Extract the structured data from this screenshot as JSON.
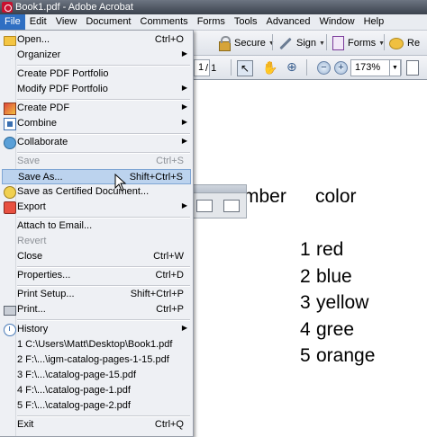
{
  "window": {
    "title": "Book1.pdf - Adobe Acrobat"
  },
  "menubar": {
    "items": [
      "File",
      "Edit",
      "View",
      "Document",
      "Comments",
      "Forms",
      "Tools",
      "Advanced",
      "Window",
      "Help"
    ],
    "active": "File"
  },
  "toolbar": {
    "secure_label": "Secure",
    "sign_label": "Sign",
    "forms_label": "Forms",
    "review_label": "Re",
    "page_number": "1",
    "page_total": "/ 1",
    "zoom": "173%"
  },
  "document": {
    "header_number": "mber",
    "header_color": "color",
    "rows": [
      {
        "n": "1",
        "c": "red"
      },
      {
        "n": "2",
        "c": "blue"
      },
      {
        "n": "3",
        "c": "yellow"
      },
      {
        "n": "4",
        "c": "gree"
      },
      {
        "n": "5",
        "c": "orange"
      }
    ]
  },
  "file_menu": {
    "open": {
      "label": "Open...",
      "shortcut": "Ctrl+O"
    },
    "organizer": {
      "label": "Organizer"
    },
    "create_portfolio": {
      "label": "Create PDF Portfolio"
    },
    "modify_portfolio": {
      "label": "Modify PDF Portfolio"
    },
    "create_pdf": {
      "label": "Create PDF"
    },
    "combine": {
      "label": "Combine"
    },
    "collaborate": {
      "label": "Collaborate"
    },
    "save": {
      "label": "Save",
      "shortcut": "Ctrl+S"
    },
    "save_as": {
      "label": "Save As...",
      "shortcut": "Shift+Ctrl+S"
    },
    "save_certified": {
      "label": "Save as Certified Document..."
    },
    "export": {
      "label": "Export"
    },
    "attach_email": {
      "label": "Attach to Email..."
    },
    "revert": {
      "label": "Revert"
    },
    "close": {
      "label": "Close",
      "shortcut": "Ctrl+W"
    },
    "properties": {
      "label": "Properties...",
      "shortcut": "Ctrl+D"
    },
    "print_setup": {
      "label": "Print Setup...",
      "shortcut": "Shift+Ctrl+P"
    },
    "print": {
      "label": "Print...",
      "shortcut": "Ctrl+P"
    },
    "history": {
      "label": "History"
    },
    "recent": [
      "1 C:\\Users\\Matt\\Desktop\\Book1.pdf",
      "2 F:\\...\\igm-catalog-pages-1-15.pdf",
      "3 F:\\...\\catalog-page-15.pdf",
      "4 F:\\...\\catalog-page-1.pdf",
      "5 F:\\...\\catalog-page-2.pdf"
    ],
    "exit": {
      "label": "Exit",
      "shortcut": "Ctrl+Q"
    }
  },
  "colors": {
    "menu_active": "#2f6fc3",
    "highlight": "#bcd3ee",
    "disabled_text": "#8e9298"
  }
}
